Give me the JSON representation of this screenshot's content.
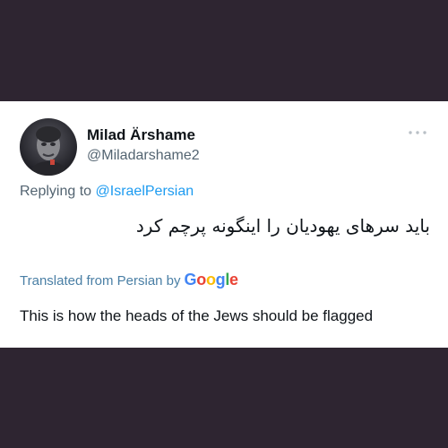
{
  "colors": {
    "background": "#2e2531",
    "card": "#ffffff",
    "text_primary": "#0f1419",
    "text_secondary": "#536471",
    "link": "#1d9bf0",
    "translated_label": "#4a7fa5",
    "google": [
      "#4285f4",
      "#ea4335",
      "#fbbc05",
      "#4285f4",
      "#34a853",
      "#ea4335"
    ]
  },
  "tweet": {
    "author": {
      "display_name": "Milad Ärshame",
      "handle": "@Miladarshame2",
      "avatar_icon": "user-avatar-photo"
    },
    "menu_icon": "more-options-icon",
    "reply": {
      "prefix": "Replying to",
      "target": "@IsraelPersian"
    },
    "text": "باید سرهای یهودیان را اینگونه پرچم کرد",
    "translation": {
      "label": "Translated from Persian by",
      "provider_letters": [
        "G",
        "o",
        "o",
        "g",
        "l",
        "e"
      ],
      "text": "This is how the heads of the Jews should be flagged"
    }
  }
}
